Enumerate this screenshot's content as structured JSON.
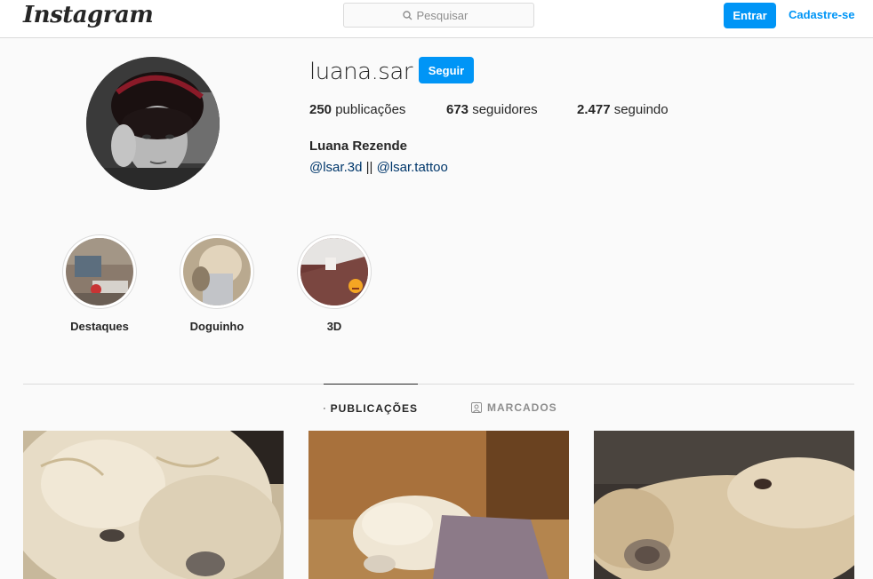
{
  "app": {
    "logo_text": "Instagram"
  },
  "nav": {
    "search_placeholder": "Pesquisar",
    "login_label": "Entrar",
    "signup_label": "Cadastre-se"
  },
  "profile": {
    "username": "luana.sar",
    "follow_label": "Seguir",
    "posts_count": "250",
    "posts_label": "publicações",
    "followers_count": "673",
    "followers_label": "seguidores",
    "following_count": "2.477",
    "following_label": "seguindo",
    "full_name": "Luana Rezende",
    "bio_link1": "@lsar.3d",
    "bio_separator": "||",
    "bio_link2": "@lsar.tattoo"
  },
  "highlights": [
    {
      "label": "Destaques"
    },
    {
      "label": "Doguinho"
    },
    {
      "label": "3D"
    }
  ],
  "tabs": [
    {
      "label": "PUBLICAÇÕES",
      "icon": "grid-icon",
      "active": true
    },
    {
      "label": "MARCADOS",
      "icon": "tagged-icon",
      "active": false
    }
  ],
  "colors": {
    "accent": "#0095f6",
    "link": "#00376b",
    "border": "#dbdbdb",
    "background": "#fafafa"
  }
}
